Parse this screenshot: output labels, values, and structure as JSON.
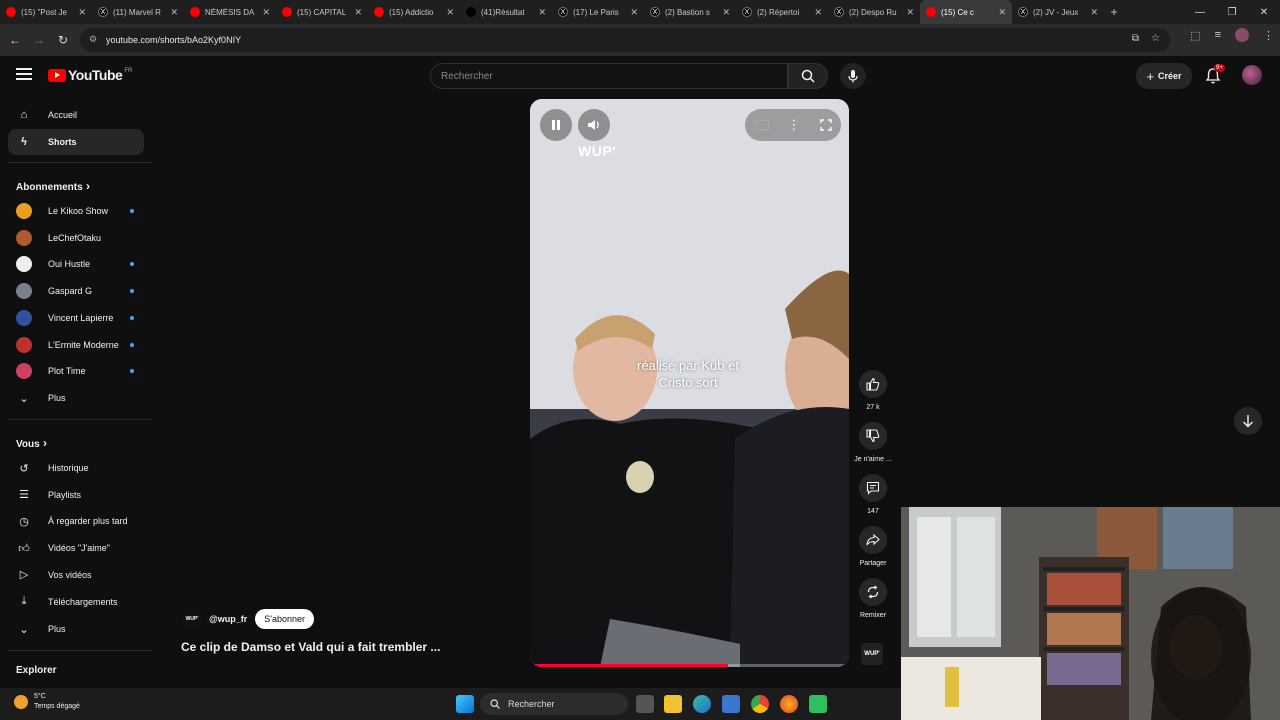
{
  "browser": {
    "tabs": [
      {
        "title": "(15) \"Post Je",
        "icon": "youtube-icon",
        "color": "#ff0000"
      },
      {
        "title": "(11) Marvel R",
        "icon": "x-icon",
        "color": "#000000"
      },
      {
        "title": "NÉMÉSIS DA",
        "icon": "youtube-icon",
        "color": "#ff0000"
      },
      {
        "title": "(15) CAPITAL",
        "icon": "youtube-icon",
        "color": "#ff0000"
      },
      {
        "title": "(15) Addictio",
        "icon": "youtube-icon",
        "color": "#ff0000"
      },
      {
        "title": "(41)Résultat",
        "icon": "tiktok-icon",
        "color": "#000000"
      },
      {
        "title": "(17) Le Paris",
        "icon": "x-icon",
        "color": "#000000"
      },
      {
        "title": "(2) Bastion s",
        "icon": "x-icon",
        "color": "#000000"
      },
      {
        "title": "(2) Répertoi",
        "icon": "x-icon",
        "color": "#000000"
      },
      {
        "title": "(2) Despo Ru",
        "icon": "x-icon",
        "color": "#000000"
      },
      {
        "title": "(15) Ce c",
        "icon": "youtube-icon",
        "color": "#ff0000",
        "active": true
      },
      {
        "title": "(2) JV - Jeux",
        "icon": "x-icon",
        "color": "#000000"
      }
    ],
    "url": "youtube.com/shorts/bAo2Kyf0NIY"
  },
  "header": {
    "logo_text": "YouTube",
    "region": "FR",
    "search_placeholder": "Rechercher",
    "create_label": "Créer",
    "notif_badge": "9+"
  },
  "sidebar": {
    "main": [
      {
        "label": "Accueil",
        "icon": "home-icon"
      },
      {
        "label": "Shorts",
        "icon": "shorts-icon",
        "active": true
      }
    ],
    "subs_heading": "Abonnements",
    "subs": [
      {
        "label": "Le Kikoo Show",
        "color": "#e8a020",
        "new": true
      },
      {
        "label": "LeChefOtaku",
        "color": "#b05a30",
        "new": false
      },
      {
        "label": "Oui Hustle",
        "color": "#f0f0f0",
        "new": true
      },
      {
        "label": "Gaspard G",
        "color": "#7a8090",
        "new": true
      },
      {
        "label": "Vincent Lapierre",
        "color": "#3050a0",
        "new": true
      },
      {
        "label": "L'Ermite Moderne",
        "color": "#c03030",
        "new": true
      },
      {
        "label": "Plot Time",
        "color": "#d04060",
        "new": true
      }
    ],
    "subs_more": "Plus",
    "you_heading": "Vous",
    "you": [
      {
        "label": "Historique",
        "icon": "history-icon"
      },
      {
        "label": "Playlists",
        "icon": "playlist-icon"
      },
      {
        "label": "À regarder plus tard",
        "icon": "clock-icon"
      },
      {
        "label": "Vidéos \"J'aime\"",
        "icon": "like-icon"
      },
      {
        "label": "Vos vidéos",
        "icon": "video-icon"
      },
      {
        "label": "Téléchargements",
        "icon": "download-icon"
      }
    ],
    "you_more": "Plus",
    "explore_heading": "Explorer"
  },
  "short": {
    "brand_overlay": "WUP'",
    "subtitle": "réalisé par Kub et Cristo sort",
    "progress": 0.62,
    "channel_handle": "@wup_fr",
    "channel_logo": "WUP'",
    "subscribe_label": "S'abonner",
    "title": "Ce clip de Damso et Vald qui a fait trembler ...",
    "likes": "27 k",
    "dislike_label": "Je n'aime ...",
    "comments": "147",
    "share_label": "Partager",
    "remix_label": "Remixer"
  },
  "taskbar": {
    "temp": "5°C",
    "weather": "Temps dégagé",
    "search": "Rechercher"
  }
}
